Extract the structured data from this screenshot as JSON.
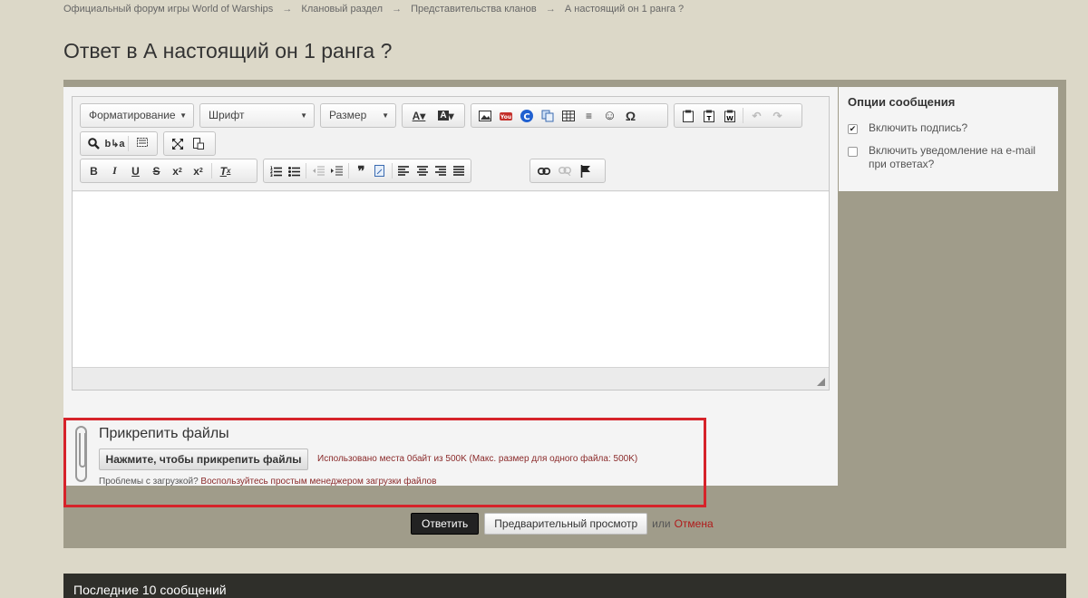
{
  "breadcrumb": {
    "items": [
      "Официальный форум игры World of Warships",
      "Клановый раздел",
      "Представительства кланов",
      "А настоящий он 1 ранга ?"
    ],
    "separator": "→"
  },
  "page": {
    "title": "Ответ в А настоящий он 1 ранга ?"
  },
  "editor": {
    "combos": {
      "format": "Форматирование",
      "font": "Шрифт",
      "size": "Размер"
    },
    "content": ""
  },
  "attach": {
    "title": "Прикрепить файлы",
    "button": "Нажмите, чтобы прикрепить файлы",
    "usage": "Использовано места 0байт из 500K (Макс. размер для одного файла: 500K)",
    "problem_text": "Проблемы с загрузкой?",
    "problem_link": "Воспользуйтесь простым менеджером загрузки файлов"
  },
  "options": {
    "title": "Опции сообщения",
    "signature": {
      "label": "Включить подпись?",
      "checked": true
    },
    "notify": {
      "label": "Включить уведомление на e-mail при ответах?",
      "checked": false
    }
  },
  "actions": {
    "reply": "Ответить",
    "preview": "Предварительный просмотр",
    "or": "или",
    "cancel": "Отмена"
  },
  "last_posts": {
    "title": "Последние 10 сообщений"
  },
  "colors": {
    "highlight_border": "#d6232a",
    "panel_bg": "#a09c8a",
    "page_bg": "#dcd8c8",
    "dark_bar": "#2f2f2a",
    "link_red": "#b01a1a"
  }
}
